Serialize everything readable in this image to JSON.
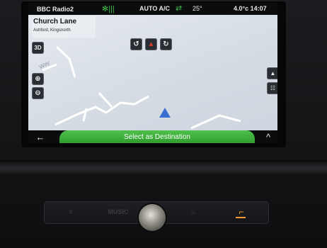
{
  "status_bar": {
    "radio_station": "BBC Radio2",
    "aircon_icon": "fan-icon",
    "climate_mode": "AUTO A/C",
    "car_icon": "recirculation-icon",
    "cabin_temp": "25°",
    "outside_temp_time": "4.0°c 14:07"
  },
  "map": {
    "street_name": "Church Lane",
    "street_area": "Ashford, Kingsnorth",
    "road_label": "Way",
    "buttons": {
      "view_3d": "3D",
      "zoom_in": "⊕",
      "zoom_out": "⊖",
      "rotate_left": "↺",
      "compass": "▲",
      "rotate_right": "↻",
      "view_mode": "▲",
      "list": "☷"
    }
  },
  "bottom_bar": {
    "back": "←",
    "select_destination": "Select as Destination",
    "expand": "^"
  },
  "console": {
    "music_label": "MUSIC",
    "park_icon": "≡",
    "seat_heat_icon": "♨",
    "seat_icon": "⌐"
  },
  "colors": {
    "accent_green": "#2f9e30",
    "marker_blue": "#3a6fd1",
    "seat_led_orange": "#f19a2a"
  }
}
